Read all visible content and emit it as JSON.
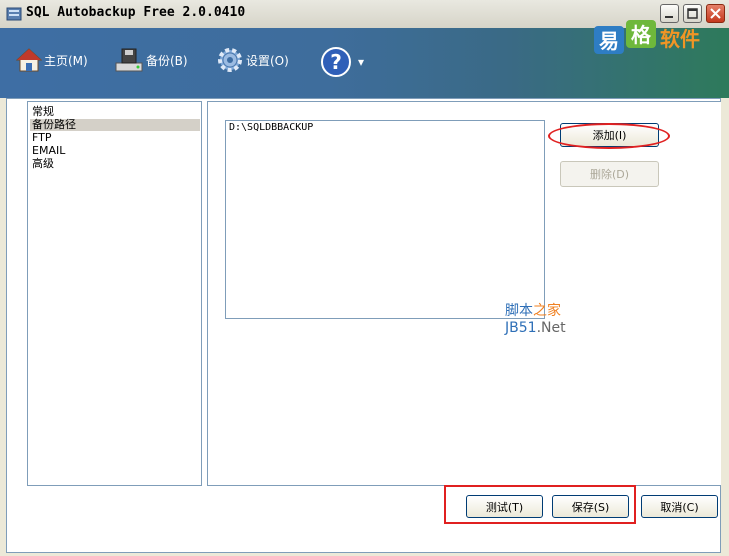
{
  "window": {
    "title": "SQL Autobackup Free 2.0.0410"
  },
  "toolbar": {
    "home_label": "主页(M)",
    "backup_label": "备份(B)",
    "settings_label": "设置(O)",
    "help_dropdown": "▾"
  },
  "logo": {
    "text_a": "易",
    "text_b": "格",
    "text_c": "软件"
  },
  "nav": {
    "items": [
      "常规",
      "备份路径",
      "FTP",
      "EMAIL",
      "高级"
    ],
    "selected_index": 1
  },
  "backup_paths": [
    "D:\\SQLDBBACKUP"
  ],
  "buttons": {
    "add": "添加(I)",
    "remove": "删除(D)",
    "test": "测试(T)",
    "save": "保存(S)",
    "cancel": "取消(C)"
  },
  "watermark": {
    "line1_a": "脚本",
    "line1_b": "之家",
    "line2_a": "JB51",
    "line2_b": ".Net"
  },
  "colors": {
    "highlight_red": "#e02020",
    "toolbar_blue": "#3e6ea4",
    "toolbar_green": "#2e7a5b"
  }
}
